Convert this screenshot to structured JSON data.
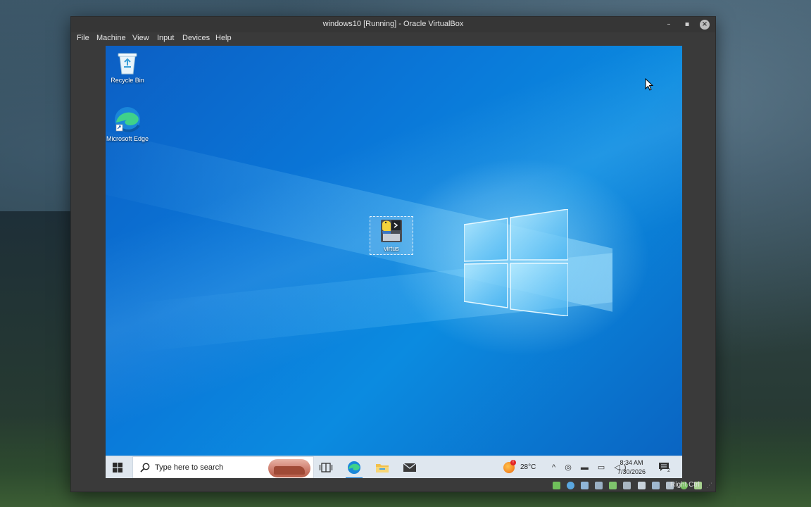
{
  "window": {
    "title": "windows10 [Running] - Oracle VirtualBox",
    "minimize_glyph": "–",
    "maximize_glyph": "▪",
    "close_glyph": "×"
  },
  "menu": {
    "file": "File",
    "machine": "Machine",
    "view": "View",
    "input": "Input",
    "devices": "Devices",
    "help": "Help"
  },
  "desktop": {
    "icons": [
      {
        "label": "Recycle Bin",
        "icon": "recycle-bin-icon"
      },
      {
        "label": "Microsoft Edge",
        "icon": "edge-icon"
      },
      {
        "label": "virtus",
        "icon": "python-file-icon",
        "selected": true
      }
    ]
  },
  "taskbar": {
    "search_placeholder": "Type here to search",
    "apps": [
      "task-view-icon",
      "edge-icon",
      "file-explorer-icon",
      "mail-icon"
    ],
    "weather_badge": "!",
    "temperature": "28°C",
    "tray_glyphs": "^ ◎ ▬ ▭ ◁)",
    "time": "8:34 AM",
    "date": "7/30/2026",
    "notification_count": "2"
  },
  "vbox_status": {
    "host_key": "Right Ctrl"
  },
  "colors": {
    "accent": "#0a78d6",
    "desktop_blue": "#0a77d8",
    "titlebar": "#363636"
  }
}
